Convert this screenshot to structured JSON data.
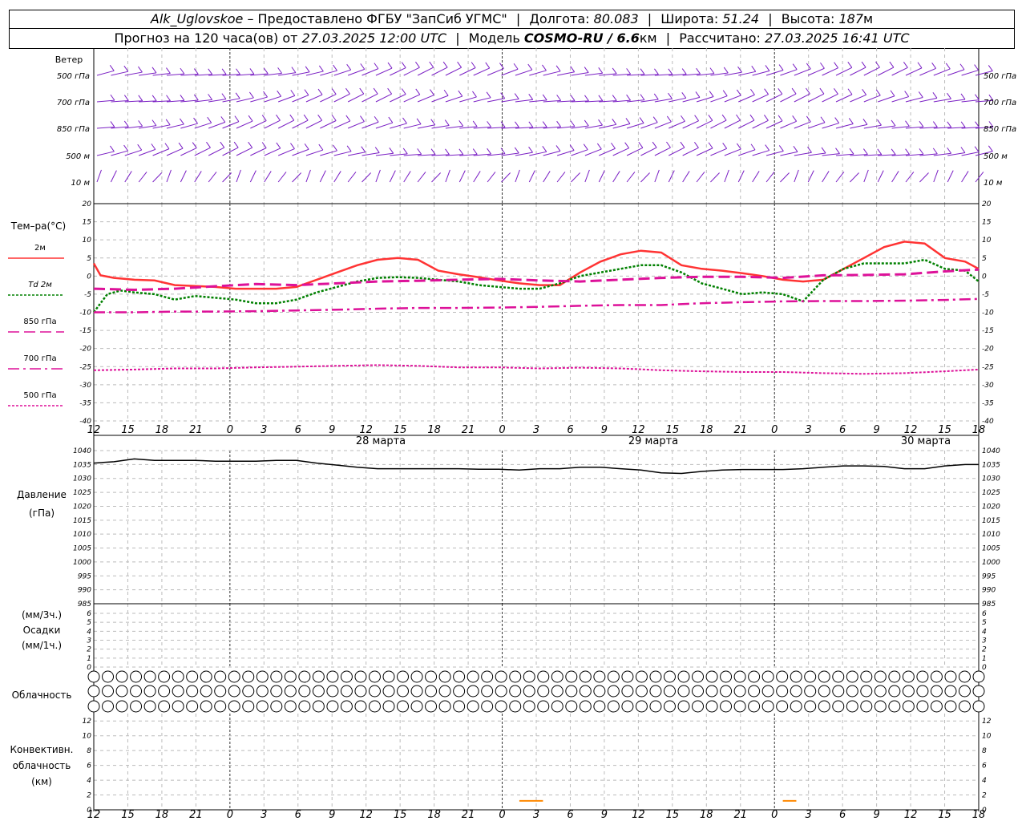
{
  "header": {
    "station": "Alk_Uglovskoe",
    "provider": "– Предоставлено ФГБУ \"ЗапСиб УГМС\"",
    "lon_label": "Долгота:",
    "lon": "80.083",
    "lat_label": "Широта:",
    "lat": "51.24",
    "alt_label": "Высота:",
    "alt": "187",
    "alt_unit": "м",
    "forecast_label": "Прогноз на 120 часа(ов) от",
    "forecast_time": "27.03.2025 12:00 UTC",
    "model_label": "Модель",
    "model": "COSMO-RU / 6.6",
    "model_unit": "км",
    "calc_label": "Рассчитано:",
    "calc_time": "27.03.2025 16:41 UTC"
  },
  "wind": {
    "title": "Ветер",
    "levels": [
      "500 гПа",
      "700 гПа",
      "850 гПа",
      "500 м",
      "10  м"
    ]
  },
  "temperature": {
    "title": "Тем–ра(°С)",
    "legend": [
      {
        "label": "2м",
        "color": "#ff3333",
        "style": "solid"
      },
      {
        "label": "Td  2м",
        "color": "#008000",
        "style": "dotted"
      },
      {
        "label": "850 гПа",
        "color": "#dd1199",
        "style": "dash"
      },
      {
        "label": "700 гПа",
        "color": "#dd1199",
        "style": "dashdot"
      },
      {
        "label": "500 гПа",
        "color": "#dd1199",
        "style": "dotted"
      }
    ]
  },
  "pressure": {
    "title": "Давление",
    "unit": "(гПа)"
  },
  "precip": {
    "line1": "(мм/3ч.)",
    "line2": "Осадки",
    "line3": "(мм/1ч.)"
  },
  "clouds": {
    "title": "Облачность"
  },
  "convective": {
    "line1": "Конвективн.",
    "line2": "облачность",
    "line3": "(км)"
  },
  "time_axis": {
    "hours": [
      "12",
      "15",
      "18",
      "21",
      "0",
      "3",
      "6",
      "9",
      "12",
      "15",
      "18",
      "21",
      "0",
      "3",
      "6",
      "9",
      "12",
      "15",
      "18",
      "21",
      "0",
      "3",
      "6",
      "9",
      "12",
      "15",
      "18"
    ],
    "dates": [
      "28 марта",
      "29 марта",
      "30 марта"
    ]
  },
  "chart_data": [
    {
      "type": "line",
      "title": "Тем–ра(°С)",
      "x_unit": "hours from 27.03.2025 12:00 UTC",
      "ylim": [
        -40,
        20
      ],
      "yticks": [
        20,
        15,
        10,
        5,
        0,
        -5,
        -10,
        -15,
        -20,
        -25,
        -30,
        -35,
        -40
      ],
      "grid": true,
      "series": [
        {
          "name": "2м",
          "x": [
            0,
            1,
            3,
            6,
            9,
            12,
            18,
            21,
            27,
            30,
            33,
            36,
            39,
            42,
            45,
            48,
            51,
            54,
            57,
            60,
            63,
            66,
            69,
            72,
            75,
            78,
            81,
            84,
            87,
            90,
            93,
            96,
            99,
            102,
            105,
            108,
            111,
            114,
            117,
            120,
            123,
            126,
            129,
            131
          ],
          "y": [
            3.5,
            0.2,
            -0.5,
            -1,
            -1.2,
            -2.5,
            -3,
            -3.5,
            -3.5,
            -3,
            -1,
            1,
            3,
            4.5,
            5,
            4.5,
            1.5,
            0.5,
            -0.3,
            -1.2,
            -2,
            -2.5,
            -2.5,
            1,
            4,
            6,
            7,
            6.5,
            3,
            2,
            1.5,
            0.8,
            0,
            -1,
            -1.5,
            -1,
            2,
            5,
            8,
            9.5,
            9,
            5,
            4,
            2
          ]
        },
        {
          "name": "Td  2м",
          "x": [
            0,
            2,
            4,
            6,
            9,
            12,
            15,
            18,
            21,
            24,
            27,
            30,
            33,
            36,
            39,
            42,
            45,
            48,
            51,
            54,
            57,
            60,
            63,
            66,
            69,
            72,
            75,
            78,
            81,
            84,
            87,
            90,
            93,
            96,
            99,
            102,
            105,
            108,
            111,
            114,
            117,
            120,
            123,
            126,
            129,
            131
          ],
          "y": [
            -10,
            -5,
            -4,
            -4.5,
            -5,
            -6.5,
            -5.5,
            -6,
            -6.5,
            -7.5,
            -7.5,
            -6.5,
            -4.5,
            -3,
            -1.5,
            -0.5,
            -0.3,
            -0.5,
            -1,
            -1.5,
            -2.5,
            -3,
            -3.5,
            -3.5,
            -2,
            0,
            1,
            2,
            3,
            3,
            1,
            -2,
            -3.5,
            -5,
            -4.5,
            -5,
            -7,
            -1,
            2,
            3.5,
            3.5,
            3.5,
            4.5,
            2,
            1.5,
            -1.5
          ]
        },
        {
          "name": "850 гПа",
          "x": [
            0,
            6,
            12,
            18,
            24,
            30,
            36,
            42,
            48,
            54,
            60,
            66,
            72,
            78,
            84,
            90,
            96,
            102,
            108,
            114,
            120,
            126,
            131
          ],
          "y": [
            -3.5,
            -3.8,
            -3.5,
            -2.8,
            -2.2,
            -2.5,
            -2,
            -1.5,
            -1.3,
            -1,
            -0.8,
            -1.2,
            -1.5,
            -1,
            -0.5,
            -0.2,
            -0.2,
            -0.5,
            0.2,
            0.3,
            0.5,
            1.3,
            1.8
          ]
        },
        {
          "name": "700 гПа",
          "x": [
            0,
            6,
            12,
            18,
            24,
            30,
            36,
            42,
            48,
            54,
            60,
            66,
            72,
            78,
            84,
            90,
            96,
            102,
            108,
            114,
            120,
            126,
            131
          ],
          "y": [
            -10,
            -10,
            -9.8,
            -9.8,
            -9.7,
            -9.5,
            -9.3,
            -9,
            -8.8,
            -8.8,
            -8.7,
            -8.5,
            -8.2,
            -8,
            -8,
            -7.5,
            -7.2,
            -7,
            -6.9,
            -6.9,
            -6.8,
            -6.6,
            -6.3
          ]
        },
        {
          "name": "500 гПа",
          "x": [
            0,
            6,
            12,
            18,
            24,
            30,
            36,
            42,
            48,
            54,
            60,
            66,
            72,
            78,
            84,
            90,
            96,
            102,
            108,
            114,
            120,
            126,
            131
          ],
          "y": [
            -26,
            -25.8,
            -25.5,
            -25.5,
            -25.2,
            -25,
            -24.8,
            -24.6,
            -24.8,
            -25.2,
            -25.2,
            -25.5,
            -25.3,
            -25.5,
            -26,
            -26.3,
            -26.5,
            -26.5,
            -26.8,
            -27,
            -26.8,
            -26.3,
            -25.8
          ]
        }
      ]
    },
    {
      "type": "line",
      "title": "Давление",
      "ylabel": "(гПа)",
      "ylim": [
        985,
        1040
      ],
      "yticks": [
        1040,
        1035,
        1030,
        1025,
        1020,
        1015,
        1010,
        1005,
        1000,
        995,
        990,
        985
      ],
      "grid": true,
      "series": [
        {
          "x": [
            0,
            3,
            6,
            9,
            12,
            15,
            18,
            21,
            24,
            27,
            30,
            33,
            36,
            39,
            42,
            45,
            48,
            51,
            54,
            57,
            60,
            63,
            66,
            69,
            72,
            75,
            78,
            81,
            84,
            87,
            90,
            93,
            96,
            99,
            102,
            105,
            108,
            111,
            114,
            117,
            120,
            123,
            126,
            129,
            131
          ],
          "y": [
            1035.5,
            1036,
            1037,
            1036.5,
            1036.5,
            1036.5,
            1036.2,
            1036.2,
            1036.2,
            1036.5,
            1036.5,
            1035.5,
            1034.8,
            1034,
            1033.5,
            1033.5,
            1033.5,
            1033.5,
            1033.5,
            1033.3,
            1033.3,
            1033,
            1033.5,
            1033.5,
            1034,
            1034,
            1033.5,
            1033,
            1032,
            1031.8,
            1032.5,
            1033,
            1033.2,
            1033.2,
            1033.2,
            1033.5,
            1034,
            1034.5,
            1034.5,
            1034.3,
            1033.5,
            1033.5,
            1034.5,
            1035,
            1035
          ]
        }
      ]
    },
    {
      "type": "bar",
      "title": "Осадки",
      "ylim": [
        0,
        6
      ],
      "yticks": [
        6,
        5,
        4,
        3,
        2,
        1,
        0
      ],
      "values": []
    },
    {
      "type": "bar",
      "title": "Конвективн. облачность (км)",
      "ylim": [
        0,
        13
      ],
      "yticks": [
        12,
        10,
        8,
        6,
        4,
        2,
        0
      ],
      "segments": [
        {
          "x_start": 63,
          "x_end": 66.5,
          "height": 1.2,
          "color": "#ff8800"
        },
        {
          "x_start": 102,
          "x_end": 104,
          "height": 1.2,
          "color": "#ff8800"
        }
      ]
    }
  ]
}
